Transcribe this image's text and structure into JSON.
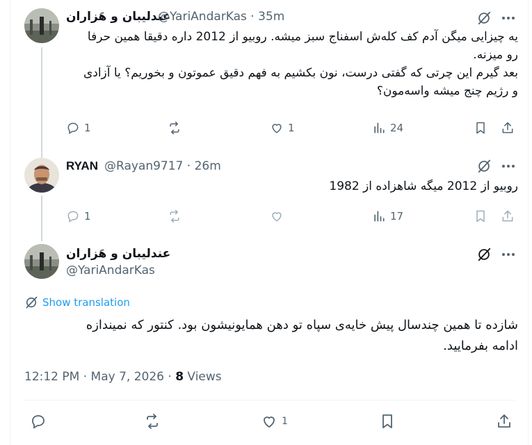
{
  "tweet1": {
    "name": "عندلیبان و هَزاران",
    "handle": "@YariAndarKas",
    "time": "35m",
    "lines": [
      "یه چیزایی میگن آدم کف کله‌ش اسفناج سبز میشه. روبیو از 2012 داره دقیقا همین حرفا",
      "رو میزنه.",
      "بعد گیرم این چرتی که گفتی درست، نون بکشیم به فهم دقیق عموتون و بخوریم؟ یا آزادی",
      "و رژیم چنج میشه واسه‌مون؟"
    ],
    "reply_count": "1",
    "repost_count": "",
    "like_count": "1",
    "views_count": "24"
  },
  "tweet2": {
    "name": "RYAN",
    "handle": "@Rayan9717",
    "time": "26m",
    "text": "روبیو از 2012 میگه شاهزاده از 1982",
    "reply_count": "1",
    "views_count": "17"
  },
  "main": {
    "name": "عندلیبان و هَزاران",
    "handle": "@YariAndarKas",
    "translate_label": "Show translation",
    "lines": [
      "شازده تا همین چندسال پیش خایه‌ی سپاه تو دهن همایونیشون بود. کنتور که نمیندازه",
      "ادامه بفرمایید."
    ],
    "timestamp": "12:12 PM · May 7, 2026 · ",
    "views_count": "8",
    "views_label": " Views",
    "like_count": "1"
  },
  "colors": {
    "accent": "#1d9bf0",
    "muted": "#536471",
    "text": "#0f1419"
  }
}
